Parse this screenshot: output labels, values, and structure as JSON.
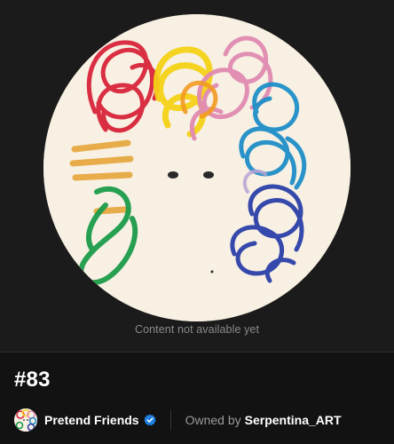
{
  "media": {
    "status_text": "Content not available yet",
    "icon": "nft-artwork-image"
  },
  "token": {
    "title": "#83"
  },
  "collection": {
    "name": "Pretend Friends",
    "verified_icon": "verified-badge-icon",
    "verified_color": "#2081e2"
  },
  "owner": {
    "prefix": "Owned by",
    "name": "Serpentina_ART"
  },
  "colors": {
    "background": "#121212",
    "panel": "#1b1b1b",
    "artwork_bg": "#f7f0e3"
  }
}
